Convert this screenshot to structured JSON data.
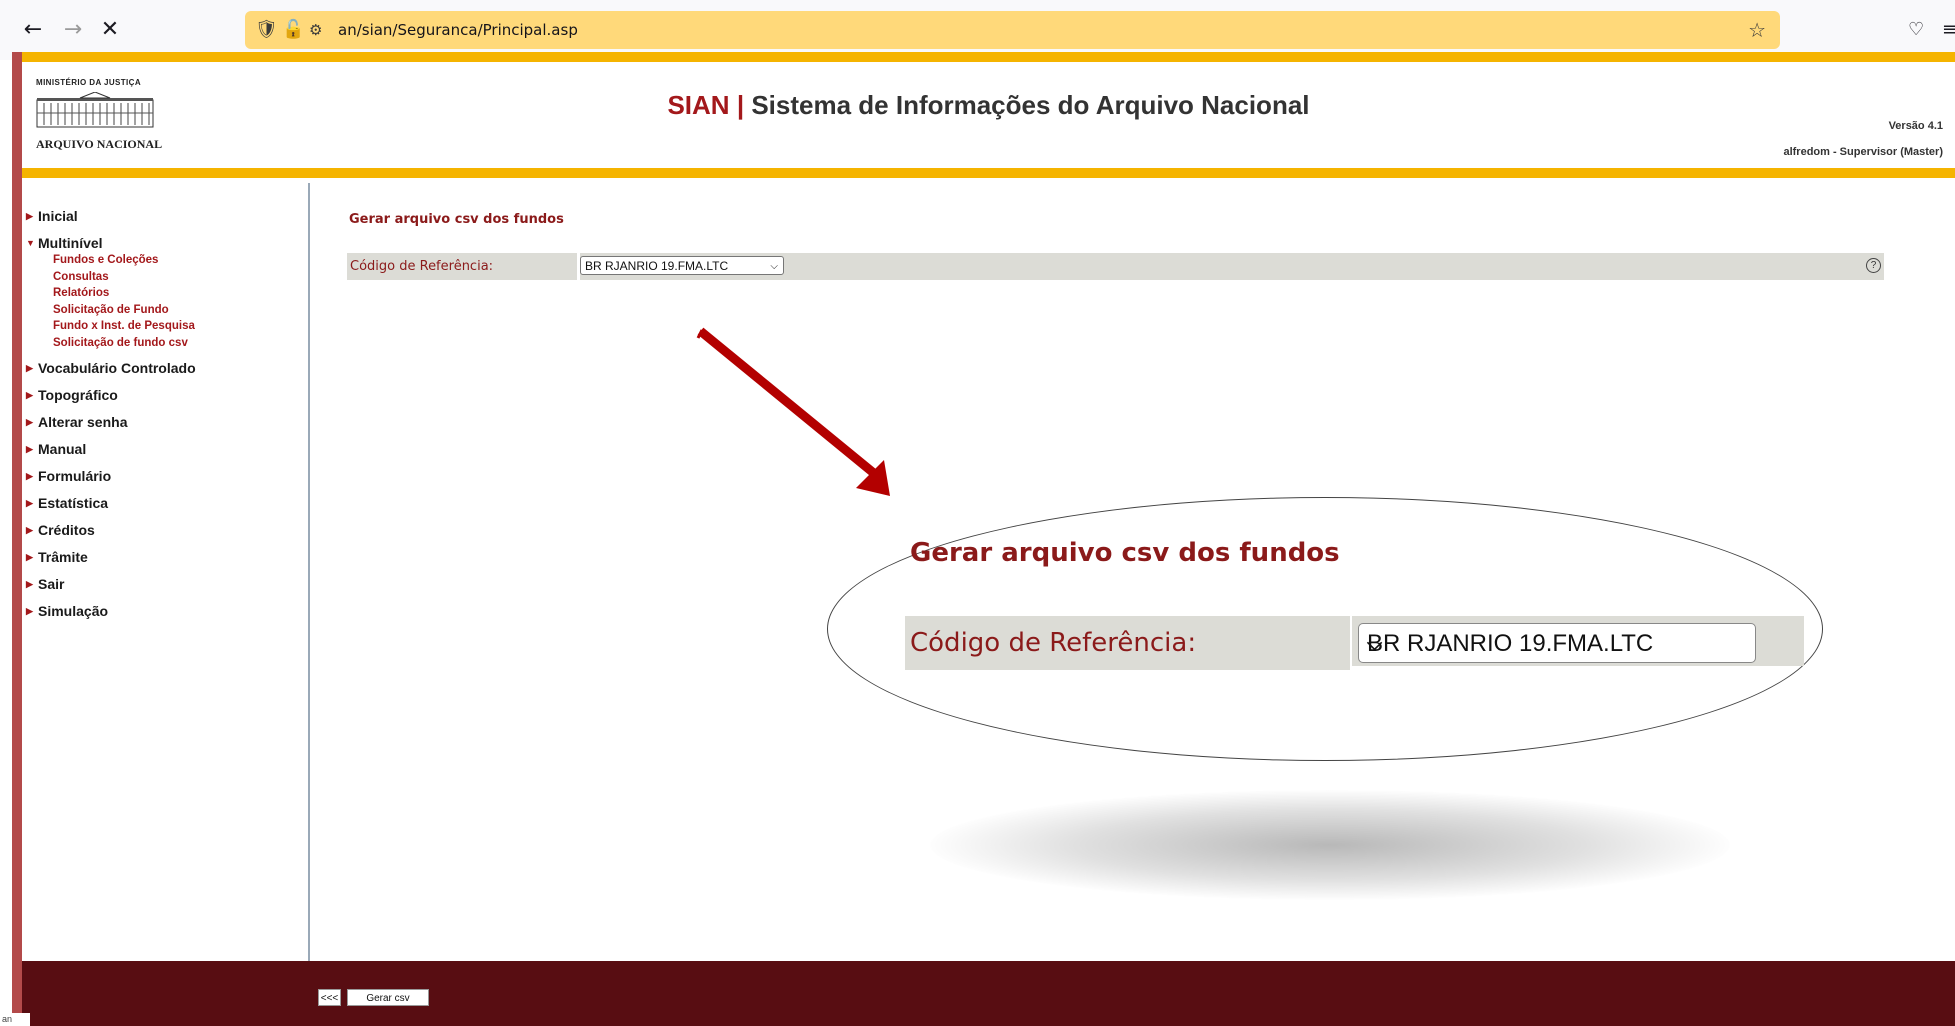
{
  "browser": {
    "url": "an/sian/Seguranca/Principal.asp",
    "back_glyph": "←",
    "forward_glyph": "→",
    "stop_glyph": "✕",
    "status_tip": "an"
  },
  "header": {
    "ministry": "MINISTÉRIO DA JUSTIÇA",
    "institution": "ARQUIVO NACIONAL",
    "title_brand": "SIAN",
    "title_sep": " | ",
    "title_rest": "Sistema de Informações do Arquivo Nacional",
    "version": "Versão 4.1",
    "user": "alfredom - Supervisor (Master)"
  },
  "sidebar": {
    "items": [
      {
        "label": "Inicial",
        "expanded": false
      },
      {
        "label": "Multinível",
        "expanded": true
      },
      {
        "label": "Vocabulário Controlado",
        "expanded": false
      },
      {
        "label": "Topográfico",
        "expanded": false
      },
      {
        "label": "Alterar senha",
        "expanded": false
      },
      {
        "label": "Manual",
        "expanded": false
      },
      {
        "label": "Formulário",
        "expanded": false
      },
      {
        "label": "Estatística",
        "expanded": false
      },
      {
        "label": "Créditos",
        "expanded": false
      },
      {
        "label": "Trâmite",
        "expanded": false
      },
      {
        "label": "Sair",
        "expanded": false
      },
      {
        "label": "Simulação",
        "expanded": false
      }
    ],
    "multinivel_sub": [
      "Fundos e Coleções",
      "Consultas",
      "Relatórios",
      "Solicitação de Fundo",
      "Fundo x Inst. de Pesquisa",
      "Solicitação de fundo csv"
    ]
  },
  "content": {
    "heading": "Gerar arquivo csv dos fundos",
    "field_label": "Código de Referência:",
    "select_value": "BR RJANRIO 19.FMA.LTC",
    "help_glyph": "?"
  },
  "zoom": {
    "heading": "Gerar arquivo csv dos fundos",
    "field_label": "Código de Referência:",
    "select_value": "BR RJANRIO 19.FMA.LTC"
  },
  "footer": {
    "back_label": "<<<",
    "generate_label": "Gerar csv"
  },
  "colors": {
    "accent_yellow": "#f5b400",
    "brand_red": "#a3181b",
    "footer_bg": "#580d12",
    "urlbar_bg": "#ffd97a"
  }
}
